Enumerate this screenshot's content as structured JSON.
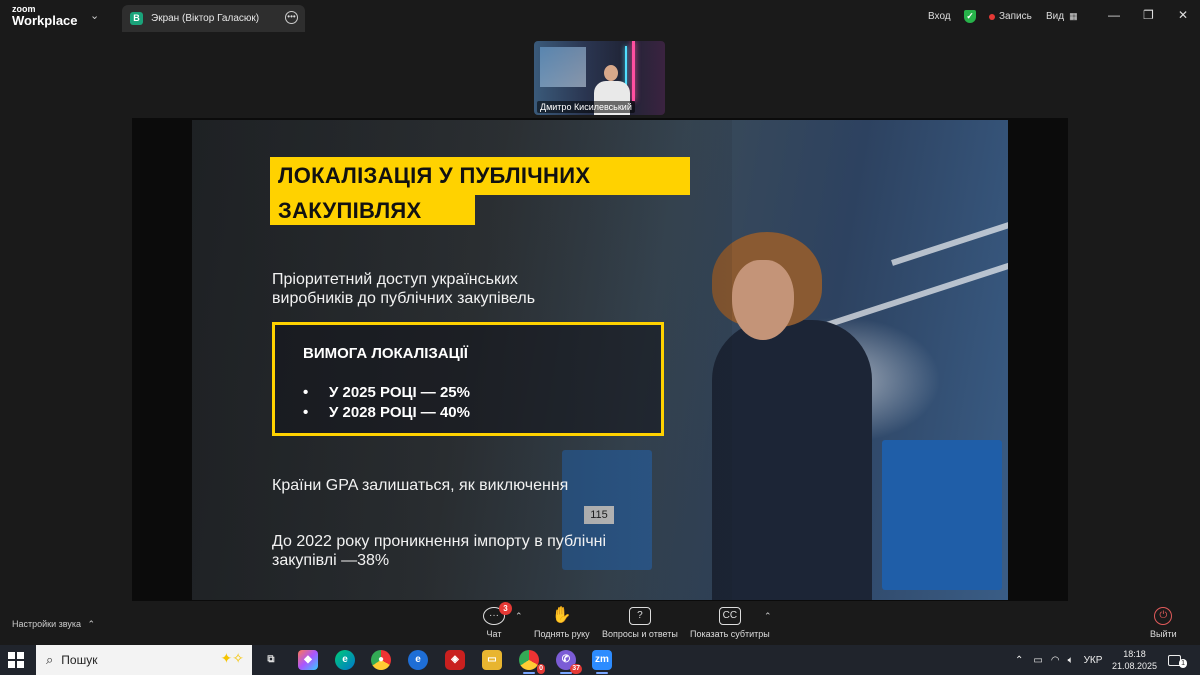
{
  "titlebar": {
    "logo_line1": "zoom",
    "logo_line2": "Workplace",
    "tab_avatar": "B",
    "tab_title": "Экран (Віктор Галасюк)",
    "login_label": "Вход",
    "record_label": "Запись",
    "view_label": "Вид"
  },
  "video": {
    "participant_name": "Дмитро Кисилевський"
  },
  "slide": {
    "title_line1": "ЛОКАЛІЗАЦІЯ У ПУБЛІЧНИХ",
    "title_line2": "ЗАКУПІВЛЯХ",
    "subtitle": "Пріоритетний доступ українських виробників до публічних закупівель",
    "requirement_title": "ВИМОГА ЛОКАЛІЗАЦІЇ",
    "requirements": [
      "У 2025 РОЦІ — 25%",
      "У 2028 РОЦІ — 40%"
    ],
    "bullet": "•",
    "paragraph1": "Країни GPA залишаться, як виключення",
    "paragraph2": "До 2022 року проникнення імпорту в публічні закупівлі —38%",
    "machine_label": "115",
    "accent_color": "#ffd200"
  },
  "toolbar": {
    "sound_settings": "Настройки звука",
    "chat_label": "Чат",
    "chat_badge": "3",
    "raise_hand_label": "Поднять руку",
    "qa_label": "Вопросы и ответы",
    "subtitles_label": "Показать субтитры",
    "exit_label": "Выйти"
  },
  "taskbar": {
    "search_placeholder": "Пошук",
    "telegram_count": "37",
    "chrome_profile_badge": "0",
    "language": "УКР",
    "time": "18:18",
    "date": "21.08.2025",
    "notification_count": "1"
  }
}
